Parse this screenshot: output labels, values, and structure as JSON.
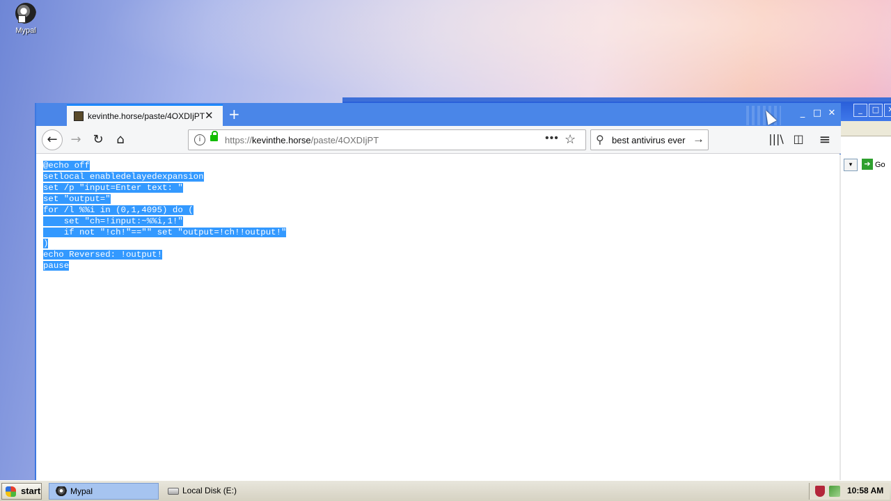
{
  "desktop": {
    "icons": [
      {
        "label": "Mypal",
        "icon": "mypal-raccoon-icon"
      }
    ]
  },
  "background_window": {
    "controls": [
      "_",
      "□",
      "✕"
    ],
    "go_label": "Go",
    "dropdown_arrow": "▾"
  },
  "browser": {
    "tab": {
      "title": "kevinthe.horse/paste/4OXDIjPT",
      "close": "✕",
      "favicon": "paste-favicon"
    },
    "new_tab": "+",
    "window_controls": {
      "minimize": "_",
      "maximize": "□",
      "close": "✕"
    },
    "nav": {
      "back": "←",
      "forward": "→",
      "reload": "↻",
      "home": "⌂"
    },
    "url": {
      "scheme": "https://",
      "host": "kevinthe.horse",
      "path": "/paste/4OXDIjPT"
    },
    "page_actions": {
      "more": "•••",
      "bookmark": "☆"
    },
    "search": {
      "value": "best antivirus ever",
      "go": "→"
    },
    "toolbar": {
      "library": "|||\\",
      "sidebar": "◫",
      "menu": "≡"
    }
  },
  "content": {
    "code_lines": [
      "@echo off",
      "setlocal enabledelayedexpansion",
      "set /p \"input=Enter text: \"",
      "set \"output=\"",
      "for /l %%i in (0,1,4095) do (",
      "    set \"ch=!input:~%%i,1!\"",
      "    if not \"!ch!\"==\"\" set \"output=!ch!!output!\"",
      ")",
      "echo Reversed: !output!",
      "pause"
    ],
    "selection_color": "#3399ff"
  },
  "taskbar": {
    "start_label": "start",
    "tasks": [
      {
        "label": "Mypal",
        "active": true
      },
      {
        "label": "Local Disk (E:)",
        "active": false
      }
    ],
    "clock": "10:58 AM"
  }
}
